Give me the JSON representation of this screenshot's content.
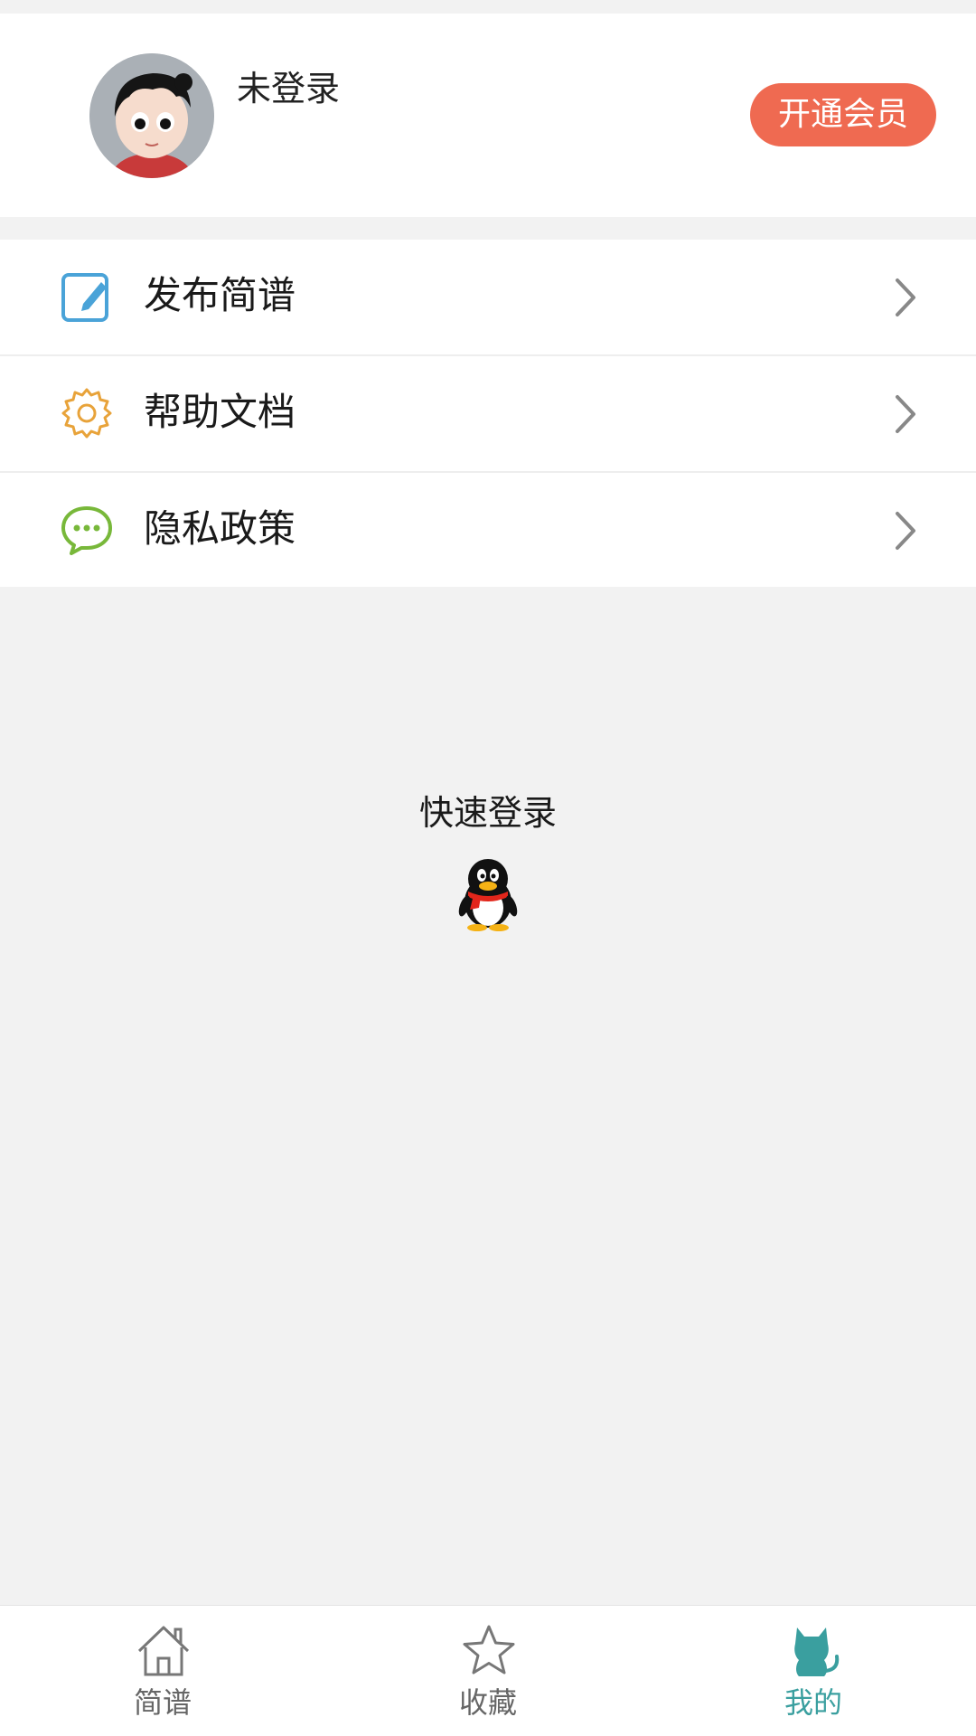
{
  "profile": {
    "username": "未登录",
    "vip_button": "开通会员"
  },
  "menu": {
    "items": [
      {
        "label": "发布简谱",
        "icon": "edit-icon",
        "icon_color": "#4aa3d8"
      },
      {
        "label": "帮助文档",
        "icon": "gear-icon",
        "icon_color": "#e8a33a"
      },
      {
        "label": "隐私政策",
        "icon": "chat-bubble-icon",
        "icon_color": "#78b83a"
      }
    ]
  },
  "quick_login": {
    "title": "快速登录",
    "icon": "qq-penguin-icon"
  },
  "tabbar": {
    "tabs": [
      {
        "label": "简谱",
        "icon": "home-icon",
        "active": false
      },
      {
        "label": "收藏",
        "icon": "star-icon",
        "active": false
      },
      {
        "label": "我的",
        "icon": "cat-icon",
        "active": true
      }
    ],
    "active_color": "#3a9f9f",
    "inactive_color": "#666666"
  },
  "colors": {
    "accent": "#ef6a51",
    "background": "#f2f2f2"
  }
}
